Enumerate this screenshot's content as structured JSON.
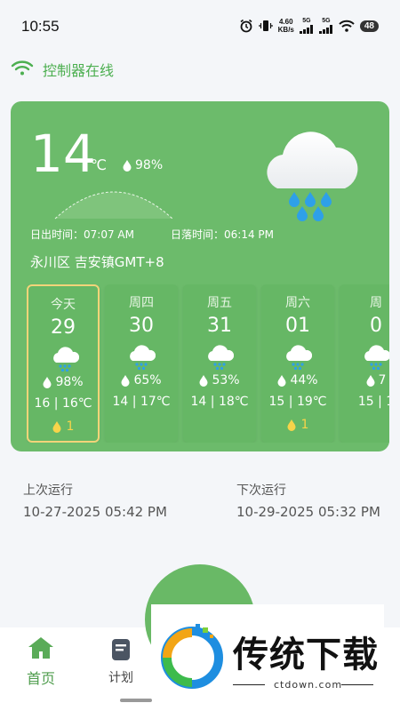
{
  "status_bar": {
    "time": "10:55",
    "net_speed_value": "4.60",
    "net_speed_unit": "KB/s",
    "signal1_label": "5G",
    "signal2_label": "5G",
    "battery": "48"
  },
  "connection": {
    "status_text": "控制器在线",
    "icon": "wifi-icon"
  },
  "weather": {
    "temperature": "14",
    "temperature_unit": "℃",
    "humidity": "98%",
    "sunrise": "日出时间：07:07 AM",
    "sunset": "日落时间：06:14 PM",
    "location": "永川区 吉安镇GMT+8",
    "icon": "cloud-rain-icon"
  },
  "forecast": [
    {
      "label": "今天",
      "date": "29",
      "humidity": "98%",
      "range": "16 | 16℃",
      "badge": "1",
      "selected": true
    },
    {
      "label": "周四",
      "date": "30",
      "humidity": "65%",
      "range": "14 | 17℃",
      "badge": "",
      "selected": false
    },
    {
      "label": "周五",
      "date": "31",
      "humidity": "53%",
      "range": "14 | 18℃",
      "badge": "",
      "selected": false
    },
    {
      "label": "周六",
      "date": "01",
      "humidity": "44%",
      "range": "15 | 19℃",
      "badge": "1",
      "selected": false
    },
    {
      "label": "周",
      "date": "0",
      "humidity": "7",
      "range": "15 | 1",
      "badge": "",
      "selected": false
    }
  ],
  "runs": {
    "last_label": "上次运行",
    "last_value": "10-27-2025 05:42 PM",
    "next_label": "下次运行",
    "next_value": "10-29-2025 05:32 PM"
  },
  "nav": {
    "home_label": "首页",
    "plan_label": "计划"
  },
  "watermark": {
    "title": "传统下载",
    "subtitle": "ctdown.com"
  },
  "colors": {
    "card": "#6cbb6b",
    "accent": "#4caf50",
    "badge": "#f7d44a"
  }
}
